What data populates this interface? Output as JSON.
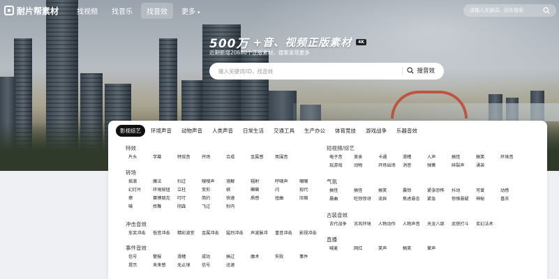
{
  "brand": {
    "name": "耐片帮素材"
  },
  "nav": {
    "items": [
      "找视频",
      "找音乐",
      "找音效",
      "更多"
    ],
    "active_index": 2
  },
  "top_search": {
    "placeholder": "请输入关键词，回车搜索"
  },
  "hero": {
    "title_big": "500万",
    "title_rest": "+音、视频正版素材",
    "badge": "4K",
    "subtitle": "近期新增20680个正版素材，搜索发现更多",
    "search_placeholder": "输入关键词/ID，找音效",
    "search_button": "搜音效"
  },
  "tabs": [
    "影视综艺",
    "环境声音",
    "动物声音",
    "人类声音",
    "日常生活",
    "交通工具",
    "生产办公",
    "体育竞技",
    "游戏战争",
    "乐器音效"
  ],
  "active_tab": 0,
  "groups": [
    {
      "title": "特效",
      "rows": [
        [
          "片头",
          "字幕",
          "特效音",
          "开场",
          "合成",
          "金属感",
          "氛围音"
        ]
      ]
    },
    {
      "title": "转场",
      "rows": [
        [
          "摇滚",
          "魔法",
          "扫过",
          "嗖嗖声",
          "溶解",
          "辐射",
          "呼啸声",
          "嘲嘲"
        ],
        [
          "幻灯片",
          "环境按钮",
          "立柱",
          "变形",
          "梆",
          "唰唰",
          "闪",
          "现代"
        ],
        [
          "擦",
          "赛博朋克",
          "叮叮",
          "简约",
          "快速",
          "质感",
          "扭曲",
          "压缩"
        ],
        [
          "噪",
          "挥舞",
          "阴森",
          "飞过",
          "秒内"
        ]
      ]
    },
    {
      "title": "冲击音效",
      "rows": [
        [
          "车奖冲击",
          "低音冲击",
          "精彩波变",
          "金属冲击",
          "猛烈冲击",
          "声波脉冲",
          "重音冲击",
          "影视冲击"
        ]
      ]
    },
    {
      "title": "事件音效",
      "rows": [
        [
          "信号",
          "警报",
          "滑稽",
          "成功",
          "搞过",
          "魔术",
          "失败",
          "事件"
        ],
        [
          "提示",
          "未来感",
          "无止境",
          "信号",
          "迅速"
        ]
      ]
    },
    {
      "title": "短视频/综艺",
      "rows": [
        [
          "电子音",
          "美食",
          "卡通",
          "滑稽",
          "人声",
          "搞怪",
          "搞笑",
          "环境音"
        ],
        [
          "玩游戏",
          "动物",
          "开场出场",
          "消音",
          "弹簧",
          "碎裂声",
          "涌苦"
        ]
      ]
    },
    {
      "title": "气氛",
      "rows": [
        [
          "搞怪",
          "搞怪",
          "搞笑",
          "震惊",
          "紧张恐怖",
          "抖动",
          "可爱",
          "动感"
        ],
        [
          "晨曲",
          "吃惊惊讶",
          "流异",
          "焦虑悬念",
          "紧急",
          "惊悚悬疑",
          "神秘",
          "喜庆"
        ]
      ]
    },
    {
      "title": "古装音效",
      "rows": [
        [
          "古代战争",
          "古风环境",
          "人物动作",
          "人物声音",
          "天龙八部",
          "武侠打斗",
          "玄幻法术"
        ]
      ]
    },
    {
      "title": "直播",
      "rows": [
        [
          "喊麦",
          "网红",
          "笑声",
          "搞笑",
          "掌声"
        ]
      ]
    }
  ]
}
